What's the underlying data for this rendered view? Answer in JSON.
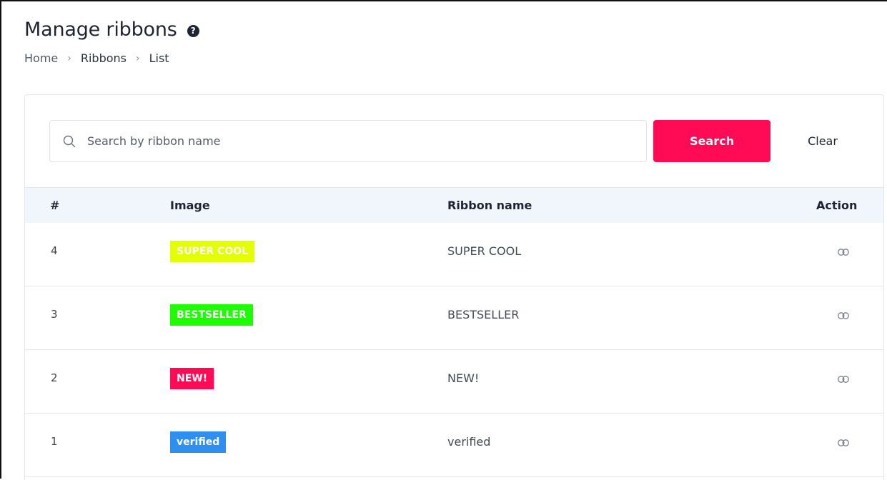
{
  "header": {
    "title": "Manage ribbons",
    "help_icon": "help-circle-icon",
    "breadcrumb": [
      "Home",
      "Ribbons",
      "List"
    ]
  },
  "search": {
    "placeholder": "Search by ribbon name",
    "value": "",
    "search_label": "Search",
    "clear_label": "Clear",
    "accent_color": "#ff0a54"
  },
  "table": {
    "columns": [
      "#",
      "Image",
      "Ribbon name",
      "Action"
    ],
    "rows": [
      {
        "id": "4",
        "ribbon_text": "SUPER COOL",
        "ribbon_color": "#e4ff00",
        "name": "SUPER COOL",
        "action_icon": "link-icon"
      },
      {
        "id": "3",
        "ribbon_text": "BESTSELLER",
        "ribbon_color": "#1cff00",
        "name": "BESTSELLER",
        "action_icon": "link-icon"
      },
      {
        "id": "2",
        "ribbon_text": "NEW!",
        "ribbon_color": "#ff0a54",
        "name": "NEW!",
        "action_icon": "link-icon"
      },
      {
        "id": "1",
        "ribbon_text": "verified",
        "ribbon_color": "#2f8ff0",
        "name": "verified",
        "action_icon": "link-icon"
      }
    ]
  }
}
